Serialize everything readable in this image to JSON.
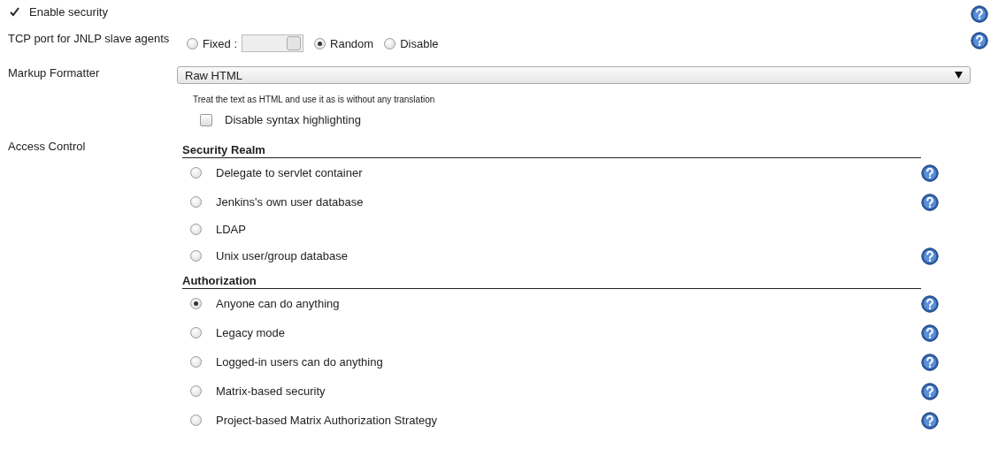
{
  "enable_security": {
    "label": "Enable security",
    "checked": true,
    "help": true
  },
  "tcp_port": {
    "label": "TCP port for JNLP slave agents",
    "help": true,
    "options": [
      {
        "kind": "field",
        "label": "Fixed :",
        "selected": false
      },
      {
        "kind": "plain",
        "label": "Random",
        "selected": true
      },
      {
        "kind": "plain",
        "label": "Disable",
        "selected": false
      }
    ]
  },
  "markup_formatter": {
    "label": "Markup Formatter",
    "value": "Raw HTML",
    "description": "Treat the text as HTML and use it as is without any translation",
    "disable_syntax_highlighting": {
      "label": "Disable syntax highlighting",
      "checked": false
    }
  },
  "access_control": {
    "label": "Access Control",
    "sections": [
      {
        "title": "Security Realm",
        "options": [
          {
            "label": "Delegate to servlet container",
            "selected": false,
            "help": true
          },
          {
            "label": "Jenkins's own user database",
            "selected": false,
            "help": true
          },
          {
            "label": "LDAP",
            "selected": false,
            "help": false
          },
          {
            "label": "Unix user/group database",
            "selected": false,
            "help": true
          }
        ]
      },
      {
        "title": "Authorization",
        "options": [
          {
            "label": "Anyone can do anything",
            "selected": true,
            "help": true
          },
          {
            "label": "Legacy mode",
            "selected": false,
            "help": true
          },
          {
            "label": "Logged-in users can do anything",
            "selected": false,
            "help": true
          },
          {
            "label": "Matrix-based security",
            "selected": false,
            "help": true
          },
          {
            "label": "Project-based Matrix Authorization Strategy",
            "selected": false,
            "help": true
          }
        ]
      }
    ]
  }
}
